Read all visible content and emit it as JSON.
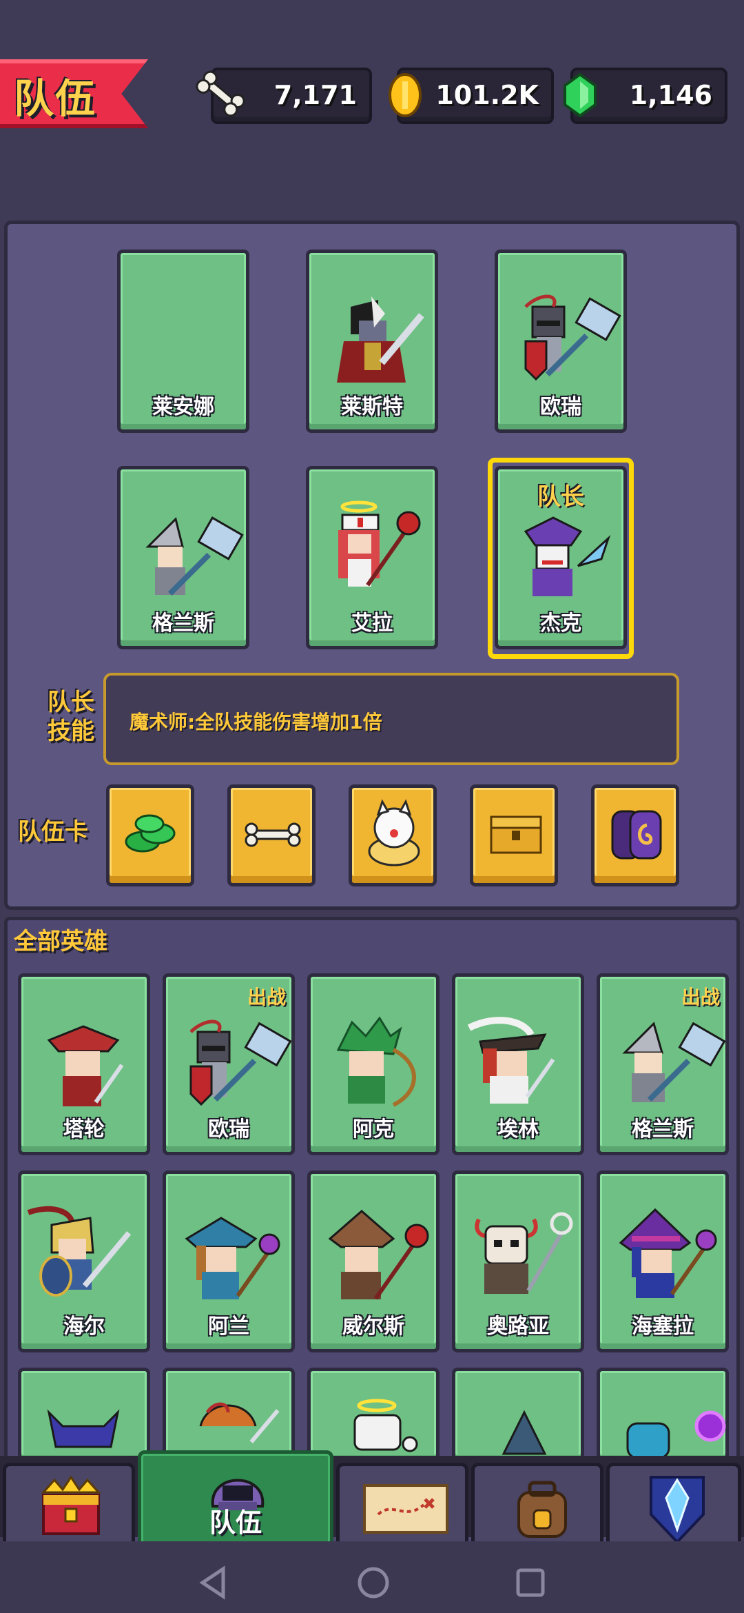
{
  "header": {
    "title": "队伍",
    "resources": [
      {
        "icon": "bone-icon",
        "value": "7,171"
      },
      {
        "icon": "gold-coin-icon",
        "value": "101.2K"
      },
      {
        "icon": "green-gem-icon",
        "value": "1,146"
      }
    ]
  },
  "team": {
    "slots": [
      {
        "name": "莱安娜"
      },
      {
        "name": "莱斯特"
      },
      {
        "name": "欧瑞"
      },
      {
        "name": "格兰斯"
      },
      {
        "name": "艾拉"
      },
      {
        "name": "杰克",
        "tag": "队长"
      }
    ],
    "leader_skill_label": "队长\n技能",
    "leader_skill_line1": "队长",
    "leader_skill_line2": "技能",
    "leader_skill_text": "魔术师:全队技能伤害增加1倍",
    "team_cards_label": "队伍卡",
    "cards": [
      "green-cash-icon",
      "bone-icon",
      "lucky-cat-icon",
      "treasure-chest-icon",
      "rune-stone-icon"
    ]
  },
  "heroes": {
    "title": "全部英雄",
    "battle_tag": "出战",
    "list": [
      {
        "name": "塔轮"
      },
      {
        "name": "欧瑞",
        "deployed": true
      },
      {
        "name": "阿克"
      },
      {
        "name": "埃林"
      },
      {
        "name": "格兰斯",
        "deployed": true
      },
      {
        "name": "海尔"
      },
      {
        "name": "阿兰"
      },
      {
        "name": "威尔斯"
      },
      {
        "name": "奥路亚"
      },
      {
        "name": "海塞拉"
      }
    ]
  },
  "nav": {
    "items": [
      "treasure-chest-icon",
      "team-helmet-icon",
      "map-scroll-icon",
      "backpack-icon",
      "crystal-shield-icon"
    ],
    "active_label": "队伍"
  }
}
